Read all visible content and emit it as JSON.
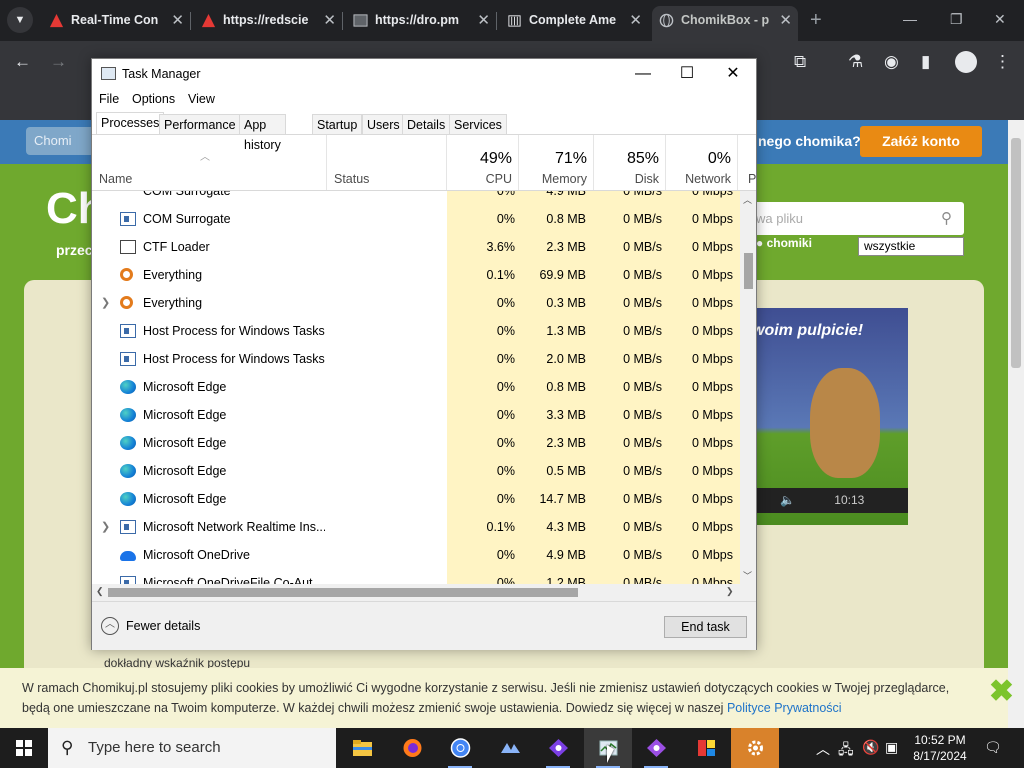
{
  "browser": {
    "tabs": [
      {
        "title": "Real-Time Con",
        "icon": "red-triangle-icon"
      },
      {
        "title": "https://redscie",
        "icon": "red-triangle-icon"
      },
      {
        "title": "https://dro.pm",
        "icon": "terminal-icon"
      },
      {
        "title": "Complete Ame",
        "icon": "building-icon"
      },
      {
        "title": "ChomikBox - p",
        "icon": "globe-icon"
      }
    ],
    "new_tab_symbol": "+"
  },
  "webpage": {
    "register_button": "Załóż konto",
    "question_text": "nego chomika?",
    "grey_button": "Chomi",
    "logo": "Ch",
    "logo_sub": "przec",
    "search_placeholder": "wa pliku",
    "radio_label": "chomiki",
    "select_value": "wszystkie",
    "promo_text": "woim pulpicie!",
    "player_time": "10:13",
    "bottom_text": "dokładny wskaźnik postępu"
  },
  "cookie_bar": {
    "line1": "W ramach Chomikuj.pl stosujemy pliki cookies by umożliwić Ci wygodne korzystanie z serwisu. Jeśli nie zmienisz ustawień dotyczących cookies w Twojej przeglądarce,",
    "line2": "będą one umieszczane na Twoim komputerze. W każdej chwili możesz zmienić swoje ustawienia. Dowiedz się więcej w naszej",
    "link": "Polityce Prywatności"
  },
  "taskmgr": {
    "title": "Task Manager",
    "menu": [
      "File",
      "Options",
      "View"
    ],
    "tabs": [
      "Processes",
      "Performance",
      "App history",
      "Startup",
      "Users",
      "Details",
      "Services"
    ],
    "active_tab": "Processes",
    "columns": {
      "name": "Name",
      "status": "Status",
      "cpu": {
        "pct": "49%",
        "label": "CPU"
      },
      "memory": {
        "pct": "71%",
        "label": "Memory"
      },
      "disk": {
        "pct": "85%",
        "label": "Disk"
      },
      "network": {
        "pct": "0%",
        "label": "Network"
      },
      "power": "P"
    },
    "partial_top_row": {
      "name": "COM Surrogate",
      "cpu": "0%",
      "memory": "4.9 MB",
      "disk": "0 MB/s",
      "network": "0 Mbps"
    },
    "rows": [
      {
        "name": "COM Surrogate",
        "icon": "window-icon",
        "expandable": false,
        "cpu": "0%",
        "memory": "0.8 MB",
        "disk": "0 MB/s",
        "network": "0 Mbps"
      },
      {
        "name": "CTF Loader",
        "icon": "ctf-icon",
        "expandable": false,
        "cpu": "3.6%",
        "memory": "2.3 MB",
        "disk": "0 MB/s",
        "network": "0 Mbps"
      },
      {
        "name": "Everything",
        "icon": "everything-search-icon",
        "expandable": false,
        "cpu": "0.1%",
        "memory": "69.9 MB",
        "disk": "0 MB/s",
        "network": "0 Mbps"
      },
      {
        "name": "Everything",
        "icon": "everything-search-icon",
        "expandable": true,
        "cpu": "0%",
        "memory": "0.3 MB",
        "disk": "0 MB/s",
        "network": "0 Mbps"
      },
      {
        "name": "Host Process for Windows Tasks",
        "icon": "window-icon",
        "expandable": false,
        "cpu": "0%",
        "memory": "1.3 MB",
        "disk": "0 MB/s",
        "network": "0 Mbps"
      },
      {
        "name": "Host Process for Windows Tasks",
        "icon": "window-icon",
        "expandable": false,
        "cpu": "0%",
        "memory": "2.0 MB",
        "disk": "0 MB/s",
        "network": "0 Mbps"
      },
      {
        "name": "Microsoft Edge",
        "icon": "edge-icon",
        "expandable": false,
        "cpu": "0%",
        "memory": "0.8 MB",
        "disk": "0 MB/s",
        "network": "0 Mbps"
      },
      {
        "name": "Microsoft Edge",
        "icon": "edge-icon",
        "expandable": false,
        "cpu": "0%",
        "memory": "3.3 MB",
        "disk": "0 MB/s",
        "network": "0 Mbps"
      },
      {
        "name": "Microsoft Edge",
        "icon": "edge-icon",
        "expandable": false,
        "cpu": "0%",
        "memory": "2.3 MB",
        "disk": "0 MB/s",
        "network": "0 Mbps"
      },
      {
        "name": "Microsoft Edge",
        "icon": "edge-icon",
        "expandable": false,
        "cpu": "0%",
        "memory": "0.5 MB",
        "disk": "0 MB/s",
        "network": "0 Mbps"
      },
      {
        "name": "Microsoft Edge",
        "icon": "edge-icon",
        "expandable": false,
        "cpu": "0%",
        "memory": "14.7 MB",
        "disk": "0 MB/s",
        "network": "0 Mbps"
      },
      {
        "name": "Microsoft Network Realtime Ins...",
        "icon": "window-icon",
        "expandable": true,
        "cpu": "0.1%",
        "memory": "4.3 MB",
        "disk": "0 MB/s",
        "network": "0 Mbps"
      },
      {
        "name": "Microsoft OneDrive",
        "icon": "onedrive-icon",
        "expandable": false,
        "cpu": "0%",
        "memory": "4.9 MB",
        "disk": "0 MB/s",
        "network": "0 Mbps"
      },
      {
        "name": "Microsoft OneDriveFile Co-Aut...",
        "icon": "window-icon",
        "expandable": false,
        "cpu": "0%",
        "memory": "1.2 MB",
        "disk": "0 MB/s",
        "network": "0 Mbps"
      }
    ],
    "fewer_details": "Fewer details",
    "end_task": "End task"
  },
  "taskbar": {
    "search_placeholder": "Type here to search",
    "apps": [
      "file-explorer-icon",
      "firefox-icon",
      "chrome-icon",
      "app-icon",
      "app-icon",
      "task-manager-icon",
      "app-icon",
      "app-icon",
      "settings-gear-icon"
    ],
    "time": "10:52 PM",
    "date": "8/17/2024"
  },
  "colors": {
    "heat_low": "#fff4c4",
    "heat_mid": "#f9eca8",
    "taskbar": "#1d1d1d",
    "chrome_dark": "#202124"
  }
}
